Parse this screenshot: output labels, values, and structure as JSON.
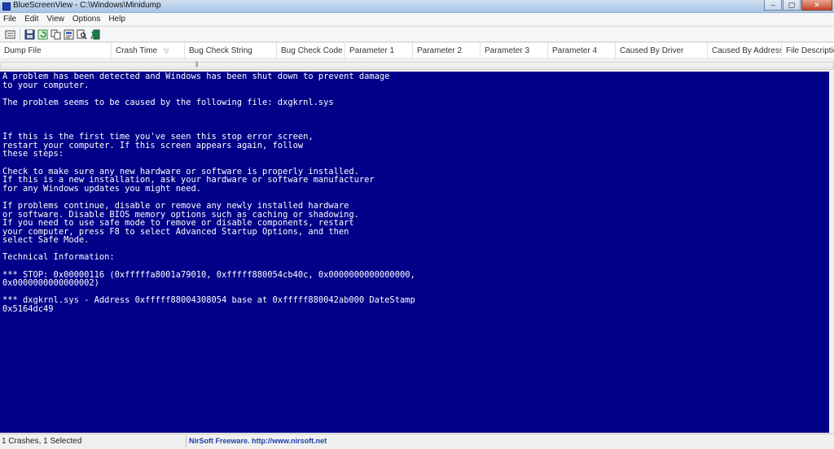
{
  "window": {
    "title": "BlueScreenView - C:\\Windows\\Minidump",
    "controls": {
      "minimize": "–",
      "maximize": "▢",
      "close": "✕"
    }
  },
  "menu": [
    "File",
    "Edit",
    "View",
    "Options",
    "Help"
  ],
  "toolbar": {
    "icons": [
      "properties-icon",
      "save-icon",
      "refresh-icon",
      "copy-icon",
      "html-report-icon",
      "find-icon",
      "exit-icon"
    ]
  },
  "columns": [
    "Dump File",
    "Crash Time",
    "Bug Check String",
    "Bug Check Code",
    "Parameter 1",
    "Parameter 2",
    "Parameter 3",
    "Parameter 4",
    "Caused By Driver",
    "Caused By Address",
    "File Description"
  ],
  "sort_indicator": "▽",
  "bsod": {
    "text": "A problem has been detected and Windows has been shut down to prevent damage\nto your computer.\n\nThe problem seems to be caused by the following file: dxgkrnl.sys\n\n\n\nIf this is the first time you've seen this stop error screen,\nrestart your computer. If this screen appears again, follow\nthese steps:\n\nCheck to make sure any new hardware or software is properly installed.\nIf this is a new installation, ask your hardware or software manufacturer\nfor any Windows updates you might need.\n\nIf problems continue, disable or remove any newly installed hardware\nor software. Disable BIOS memory options such as caching or shadowing.\nIf you need to use safe mode to remove or disable components, restart\nyour computer, press F8 to select Advanced Startup Options, and then\nselect Safe Mode.\n\nTechnical Information:\n\n*** STOP: 0x00000116 (0xfffffa8001a79010, 0xfffff880054cb40c, 0x0000000000000000,\n0x0000000000000002)\n\n*** dxgkrnl.sys - Address 0xfffff88004308054 base at 0xfffff880042ab000 DateStamp\n0x5164dc49"
  },
  "status": {
    "selection": "1 Crashes, 1 Selected",
    "credit": "NirSoft Freeware.  http://www.nirsoft.net"
  },
  "colors": {
    "bsod_background": "#000088",
    "bsod_text": "#ffffff",
    "link": "#1f3fa8"
  }
}
